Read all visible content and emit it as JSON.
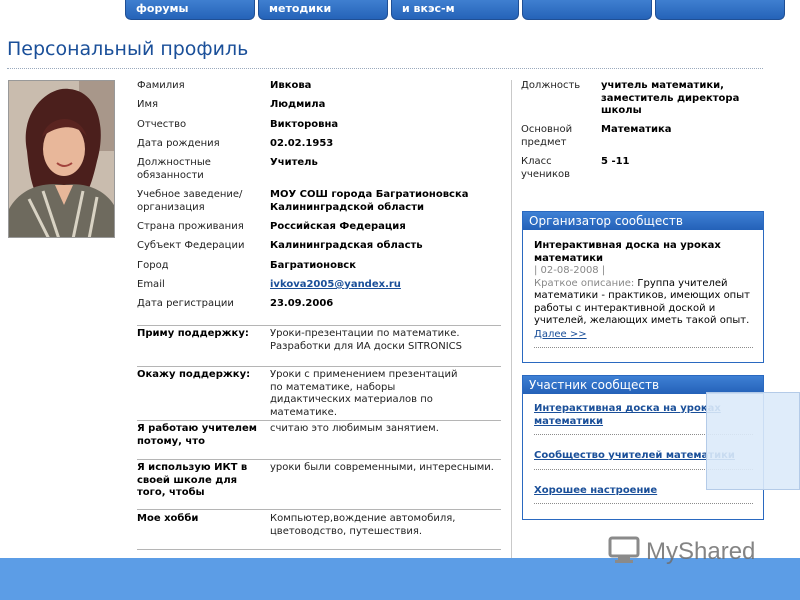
{
  "nav": {
    "tabs": [
      "форумы",
      "методики",
      "и вкэс-м",
      "",
      ""
    ]
  },
  "page_title": "Персональный профиль",
  "profile_fields": [
    {
      "label": "Фамилия",
      "value": "Ивкова"
    },
    {
      "label": "Имя",
      "value": "Людмила"
    },
    {
      "label": "Отчество",
      "value": "Викторовна"
    },
    {
      "label": "Дата рождения",
      "value": "02.02.1953"
    },
    {
      "label": "Должностные обязанности",
      "value": "Учитель"
    },
    {
      "label": "Учебное заведение/организация",
      "value": "МОУ СОШ города Багратионовска Калининградской области"
    },
    {
      "label": "Страна проживания",
      "value": "Российская Федерация"
    },
    {
      "label": "Субъект Федерации",
      "value": "Калининградская область"
    },
    {
      "label": "Город",
      "value": "Багратионовск"
    },
    {
      "label": "Email",
      "value": "ivkova2005@yandex.ru"
    },
    {
      "label": "Дата регистрации",
      "value": "23.09.2006"
    }
  ],
  "questions": [
    {
      "label": "Приму поддержку:",
      "value": "Уроки-презентации по математике. Разработки для ИА доски SITRONICS"
    },
    {
      "label": "Окажу поддержку:",
      "value": "Уроки с применением презентаций по математике, наборы дидактических материалов по математике."
    },
    {
      "label": "Я работаю учителем потому, что",
      "value": "считаю это любимым занятием."
    },
    {
      "label": "Я использую ИКТ в своей школе для того, чтобы",
      "value": "уроки были современными, интересными."
    },
    {
      "label": "Мое хобби",
      "value": "Компьютер,вождение автомобиля, цветоводство, путешествия."
    }
  ],
  "right_fields": [
    {
      "label": "Должность",
      "value": "учитель математики, заместитель директора школы"
    },
    {
      "label": "Основной предмет",
      "value": "Математика"
    },
    {
      "label": "Класс учеников",
      "value": "5 -11"
    }
  ],
  "organizer_box": {
    "title": "Организатор сообществ",
    "community_title": "Интерактивная доска на уроках математики",
    "date": "| 02-08-2008 |",
    "desc_label": "Краткое описание:",
    "desc_text": "Группа учителей математики - практиков, имеющих опыт работы с интерактивной доской и учителей, желающих иметь такой опыт.",
    "more_link": "Далее >>"
  },
  "member_box": {
    "title": "Участник сообществ",
    "links": [
      "Интерактивная доска на уроках математики",
      "Сообщество учителей математики",
      "Хорошее настроение"
    ]
  },
  "watermark": "MyShared",
  "colors": {
    "nav_tab": "#2f6fc6",
    "title": "#1a4f99",
    "link": "#1a4f99",
    "bottom_bar": "#5c9de6"
  }
}
